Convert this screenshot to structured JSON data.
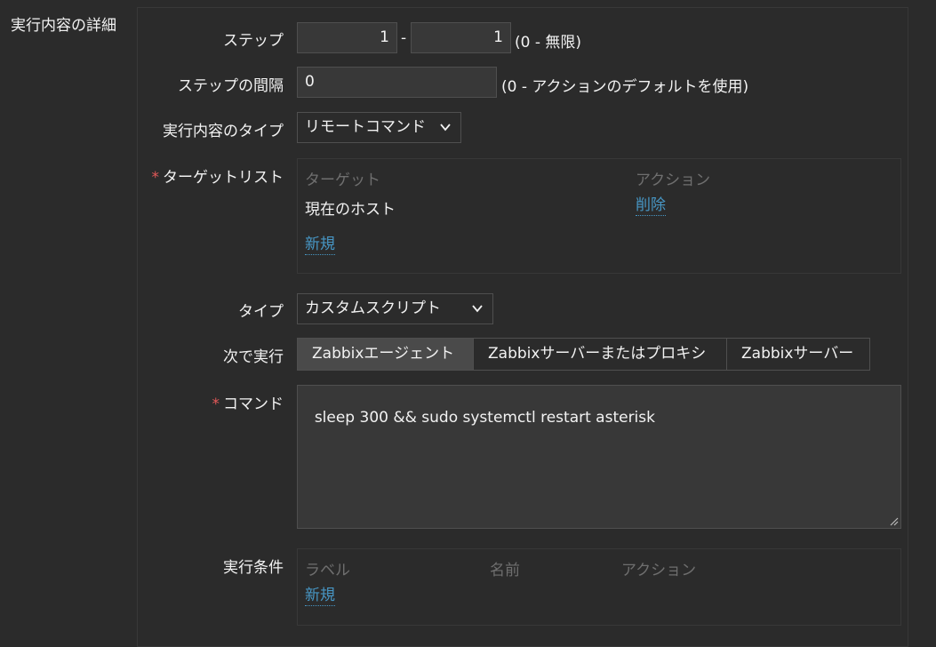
{
  "section_title": "実行内容の詳細",
  "steps": {
    "label": "ステップ",
    "from": "1",
    "separator": "-",
    "to": "1",
    "hint": "(0 - 無限)"
  },
  "step_interval": {
    "label": "ステップの間隔",
    "value": "0",
    "hint": "(0 - アクションのデフォルトを使用)"
  },
  "operation_type": {
    "label": "実行内容のタイプ",
    "selected": "リモートコマンド"
  },
  "target_list": {
    "label": "ターゲットリスト",
    "columns": [
      "ターゲット",
      "アクション"
    ],
    "rows": [
      {
        "target": "現在のホスト",
        "action": "削除"
      }
    ],
    "add_link": "新規"
  },
  "type": {
    "label": "タイプ",
    "selected": "カスタムスクリプト"
  },
  "execute_on": {
    "label": "次で実行",
    "options": [
      "Zabbixエージェント",
      "Zabbixサーバーまたはプロキシ",
      "Zabbixサーバー"
    ],
    "active_index": 0
  },
  "command": {
    "label": "コマンド",
    "value": "sleep 300 && sudo systemctl restart asterisk"
  },
  "conditions": {
    "label": "実行条件",
    "columns": [
      "ラベル",
      "名前",
      "アクション"
    ],
    "add_link": "新規"
  },
  "colors": {
    "background": "#2b2b2b",
    "input_bg": "#383838",
    "link": "#4796c4",
    "required": "#e45959"
  }
}
